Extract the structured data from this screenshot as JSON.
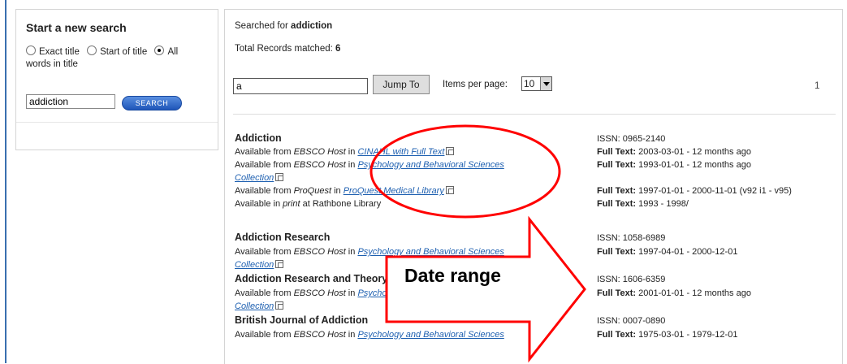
{
  "search_panel": {
    "title": "Start a new search",
    "radio_exact": "Exact title",
    "radio_start": "Start of title",
    "radio_all": "All",
    "radio_all_cont": "words in title",
    "query_value": "addiction",
    "search_button": "SEARCH"
  },
  "results_header": {
    "searched_prefix": "Searched for ",
    "searched_term": "addiction",
    "total_prefix": "Total Records matched: ",
    "total_count": "6",
    "jump_value": "a",
    "jump_button": "Jump To",
    "items_per_page_label": "Items per page:",
    "items_per_page_value": "10",
    "page_number": "1"
  },
  "results": [
    {
      "title": "Addiction",
      "lines": [
        {
          "prefix": "Available from ",
          "provider": "EBSCO Host",
          "mid": " in ",
          "link": "CINAHL with Full Text"
        },
        {
          "prefix": "Available from ",
          "provider": "EBSCO Host",
          "mid": " in ",
          "link": "Psychology and Behavioral Sciences"
        },
        {
          "link_cont": "Collection"
        },
        {
          "prefix": "Available from ",
          "provider": "ProQuest",
          "mid": " in ",
          "link": "ProQuest Medical Library"
        },
        {
          "prefix": "Available in ",
          "provider": "print",
          "mid": " at Rathbone Library",
          "link": ""
        }
      ],
      "issn": "ISSN: 0965-2140",
      "fulltext": [
        {
          "label": "Full Text:",
          "value": " 2003-03-01 - 12 months ago"
        },
        {
          "label": "Full Text:",
          "value": " 1993-01-01 - 12 months ago"
        },
        {
          "label": "Full Text:",
          "value": " 1997-01-01 - 2000-11-01 (v92 i1 - v95)"
        },
        {
          "label": "Full Text:",
          "value": " 1993 - 1998/"
        }
      ]
    },
    {
      "title": "Addiction Research",
      "lines": [
        {
          "prefix": "Available from ",
          "provider": "EBSCO Host",
          "mid": " in ",
          "link": "Psychology and Behavioral Sciences"
        },
        {
          "link_cont": "Collection"
        }
      ],
      "issn": "ISSN: 1058-6989",
      "fulltext": [
        {
          "label": "Full Text:",
          "value": " 1997-04-01 - 2000-12-01"
        }
      ]
    },
    {
      "title": "Addiction Research and Theory",
      "lines": [
        {
          "prefix": "Available from ",
          "provider": "EBSCO Host",
          "mid": " in ",
          "link": "Psychology and Behavioral Sciences"
        },
        {
          "link_cont": "Collection"
        }
      ],
      "issn": "ISSN: 1606-6359",
      "fulltext": [
        {
          "label": "Full Text:",
          "value": " 2001-01-01 - 12 months ago"
        }
      ]
    },
    {
      "title": "British Journal of Addiction",
      "lines": [
        {
          "prefix": "Available from ",
          "provider": "EBSCO Host",
          "mid": " in ",
          "link": "Psychology and Behavioral Sciences"
        }
      ],
      "issn": "ISSN: 0007-0890",
      "fulltext": [
        {
          "label": "Full Text:",
          "value": " 1975-03-01 - 1979-12-01"
        }
      ]
    }
  ],
  "annotation": {
    "callout_text": "Date range",
    "color": "#ff0000"
  }
}
